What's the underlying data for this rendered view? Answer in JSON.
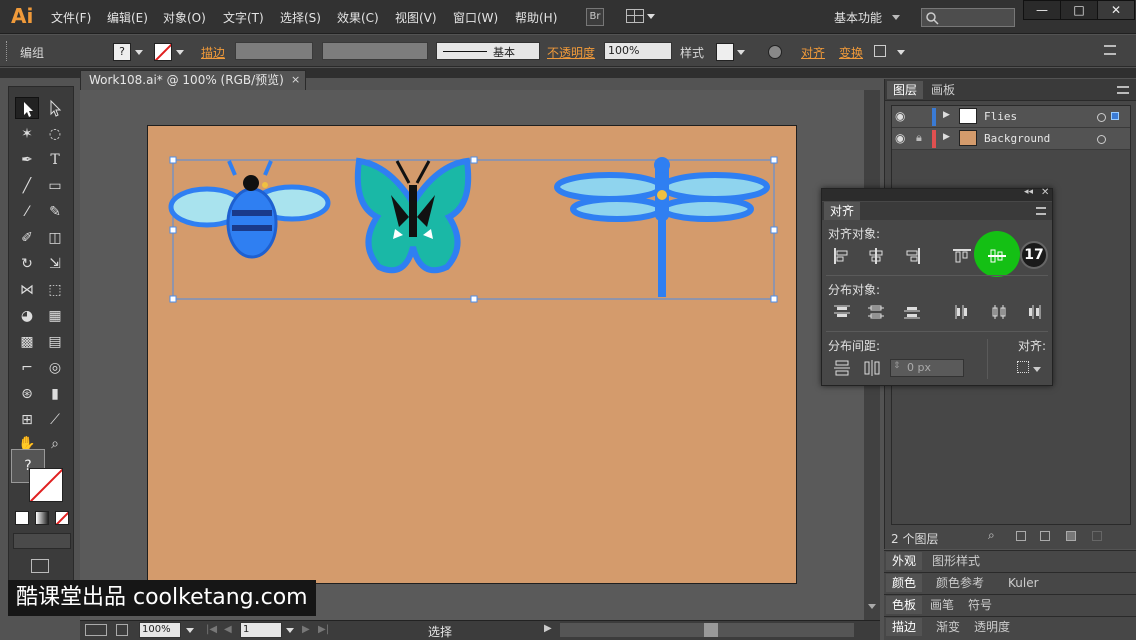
{
  "app": {
    "logo": "Ai"
  },
  "menu": [
    "文件(F)",
    "编辑(E)",
    "对象(O)",
    "文字(T)",
    "选择(S)",
    "效果(C)",
    "视图(V)",
    "窗口(W)",
    "帮助(H)"
  ],
  "bridge_button": "Br",
  "workspace": "基本功能",
  "window_controls": {
    "min": "—",
    "max": "□",
    "close": "✕"
  },
  "control": {
    "selection": "编组",
    "stroke_label": "描边",
    "stroke_style": "基本",
    "opacity_label": "不透明度",
    "opacity_value": "100%",
    "style_label": "样式",
    "align_label": "对齐",
    "transform_label": "变换"
  },
  "document": {
    "tab_title": "Work108.ai* @ 100% (RGB/预览)"
  },
  "layers_panel": {
    "tabs": [
      "图层",
      "画板"
    ],
    "layers": [
      {
        "name": "Flies",
        "color": "#3a7bd5",
        "locked": false
      },
      {
        "name": "Background",
        "color": "#e05050",
        "locked": true
      }
    ],
    "count": "2 个图层"
  },
  "align_panel": {
    "title": "对齐",
    "align_objects": "对齐对象:",
    "distribute_objects": "分布对象:",
    "distribute_spacing": "分布间距:",
    "align_to": "对齐:",
    "spacing_value": "0 px",
    "step_badge": "17"
  },
  "panels": {
    "row1": [
      "外观",
      "图形样式"
    ],
    "row2": [
      "颜色",
      "颜色参考",
      "Kuler"
    ],
    "row3": [
      "色板",
      "画笔",
      "符号"
    ],
    "row4": [
      "描边",
      "渐变",
      "透明度"
    ]
  },
  "statusbar": {
    "zoom": "100%",
    "page": "1",
    "tool": "选择"
  },
  "toolbox": {
    "question": "?"
  },
  "watermark": "酷课堂出品 coolketang.com",
  "colors": {
    "artboard": "#d49b6c",
    "highlight": "#14c014",
    "accent": "#f09a3a"
  }
}
